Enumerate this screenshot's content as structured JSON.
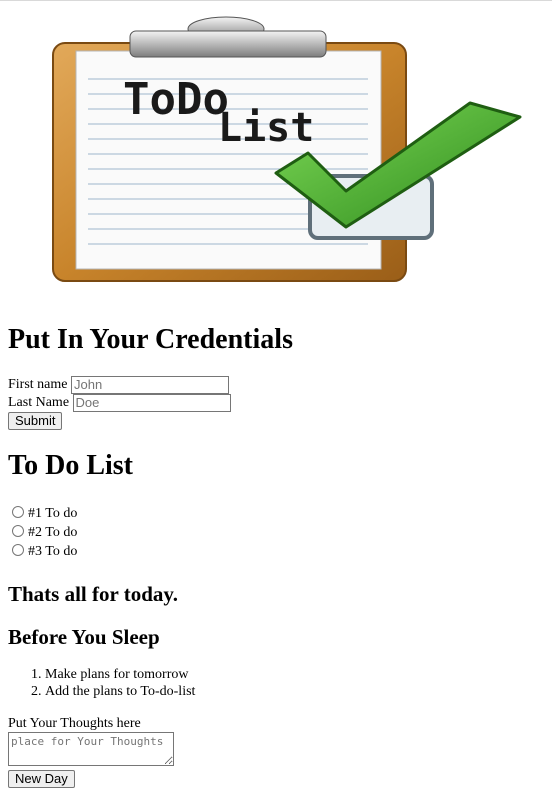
{
  "hero": {
    "board_title_line1": "ToDo",
    "board_title_line2": "List"
  },
  "credentials": {
    "heading": "Put In Your Credentials",
    "first_name_label": "First name",
    "first_name_placeholder": "John",
    "last_name_label": "Last Name",
    "last_name_placeholder": "Doe",
    "submit_label": "Submit"
  },
  "todo": {
    "heading": "To Do List",
    "items": [
      {
        "label": "#1 To do"
      },
      {
        "label": "#2 To do"
      },
      {
        "label": "#3 To do"
      }
    ],
    "footer": "Thats all for today."
  },
  "sleep": {
    "heading": "Before You Sleep",
    "items": [
      "Make plans for tomorrow",
      "Add the plans to To-do-list"
    ]
  },
  "thoughts": {
    "label": "Put Your Thoughts here",
    "placeholder": "place for Your Thoughts",
    "button_label": "New Day"
  },
  "colors": {
    "board_frame": "#c8842b",
    "check_green": "#3fae2a"
  }
}
